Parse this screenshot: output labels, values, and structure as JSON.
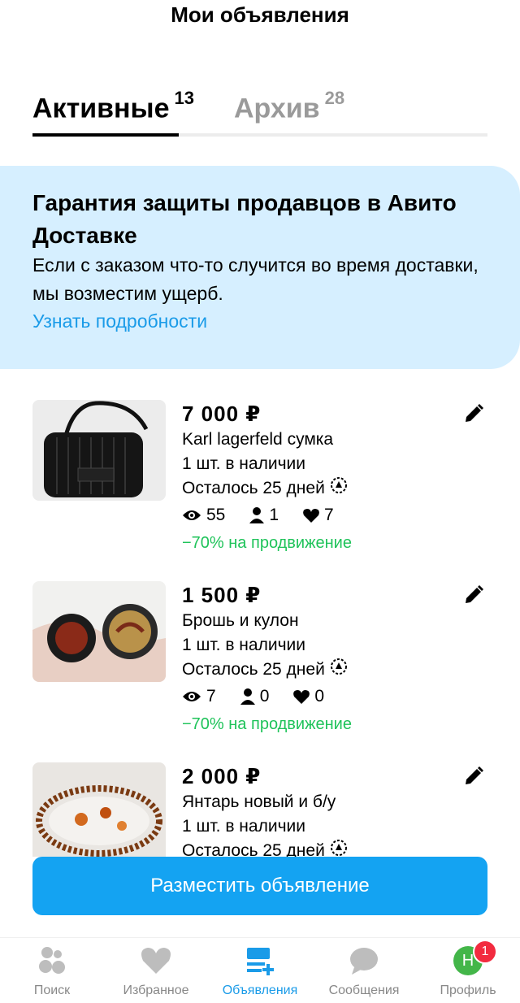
{
  "header": {
    "title": "Мои объявления"
  },
  "tabs": [
    {
      "label": "Активные",
      "count": "13"
    },
    {
      "label": "Архив",
      "count": "28"
    }
  ],
  "banner": {
    "title": "Гарантия защиты продавцов в Авито Доставке",
    "text": "Если с заказом что-то случится во время доставки, мы возместим ущерб.",
    "link": "Узнать подробности"
  },
  "listings": [
    {
      "price": "7 000 ₽",
      "title": "Karl lagerfeld сумка",
      "stock": "1 шт. в наличии",
      "remaining": "Осталось 25 дней",
      "views": "55",
      "contacts": "1",
      "favorites": "7",
      "promo": "−70% на продвижение"
    },
    {
      "price": "1 500 ₽",
      "title": "Брошь и кулон",
      "stock": "1 шт. в наличии",
      "remaining": "Осталось 25 дней",
      "views": "7",
      "contacts": "0",
      "favorites": "0",
      "promo": "−70% на продвижение"
    },
    {
      "price": "2 000 ₽",
      "title": "Янтарь новый и б/у",
      "stock": "1 шт. в наличии",
      "remaining": "Осталось 25 дней"
    }
  ],
  "post_button": {
    "label": "Разместить объявление"
  },
  "bottom_nav": {
    "items": [
      {
        "label": "Поиск",
        "icon": "search-dots-icon"
      },
      {
        "label": "Избранное",
        "icon": "heart-icon"
      },
      {
        "label": "Объявления",
        "icon": "listings-add-icon",
        "active": true
      },
      {
        "label": "Сообщения",
        "icon": "chat-bubble-icon"
      },
      {
        "label": "Профиль",
        "icon": "avatar",
        "avatar_letter": "Н",
        "badge": "1"
      }
    ]
  },
  "colors": {
    "accent": "#14a3f2",
    "link": "#1a9be8",
    "promo": "#1fc35a",
    "banner_bg": "#d6efff",
    "badge": "#f22b3f"
  }
}
